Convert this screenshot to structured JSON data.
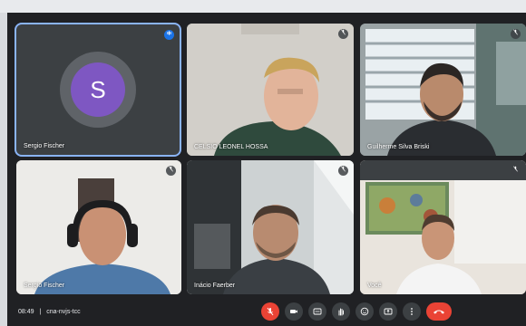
{
  "participants": [
    {
      "name": "Sergio Fischer",
      "avatar_letter": "S",
      "speaking": true
    },
    {
      "name": "CELSIO LEONEL HOSSA",
      "speaking": false
    },
    {
      "name": "Guilherme Silva Briski",
      "speaking": false
    },
    {
      "name": "Sergio Fischer",
      "speaking": false
    },
    {
      "name": "Inácio Faerber",
      "speaking": false
    },
    {
      "name": "Você",
      "speaking": false
    }
  ],
  "meeting": {
    "time": "08:49",
    "separator": "|",
    "code": "cna-nvjs-tcc"
  },
  "controls": {
    "icons": [
      "mic-off-icon",
      "camera-icon",
      "captions-icon",
      "raise-hand-icon",
      "emoji-icon",
      "present-icon",
      "more-icon",
      "end-call-icon"
    ]
  },
  "colors": {
    "background": "#202124",
    "tile": "#3c4043",
    "avatar": "#7e57c2",
    "active_border": "#8ab4f8",
    "danger": "#ea4335"
  }
}
